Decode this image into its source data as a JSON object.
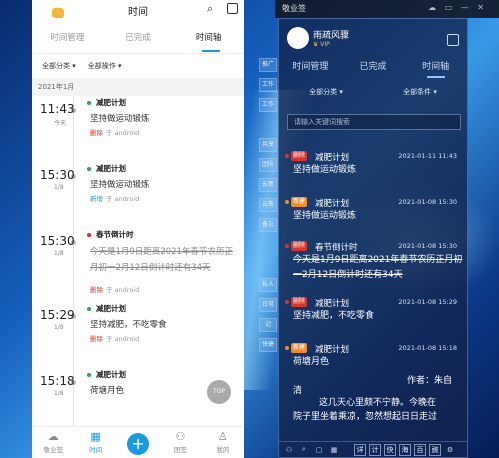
{
  "phone": {
    "title": "时间",
    "tabs": [
      "时间管理",
      "已完成",
      "时间轴"
    ],
    "filters": [
      "全部分类 ▾",
      "全部操作 ▾"
    ],
    "month": "2021年1月",
    "entries": [
      {
        "time": "11:43",
        "date": "今天",
        "title": "减肥计划",
        "content": "坚持做运动锻炼",
        "action": "删除",
        "source": "于 android",
        "bullet": "#2fa84f",
        "strike": false
      },
      {
        "time": "15:30",
        "date": "1/8",
        "title": "减肥计划",
        "content": "坚持做运动锻炼",
        "action": "新增",
        "source": "于 android",
        "bullet": "#2fa84f",
        "strike": false
      },
      {
        "time": "15:30",
        "date": "1/8",
        "title": "春节倒计时",
        "content": "今天是1月9日距离2021年春节农历正月初一2月12日倒计时还有34天",
        "action": "删除",
        "source": "于 android",
        "bullet": "#d9342b",
        "strike": true
      },
      {
        "time": "15:29",
        "date": "1/8",
        "title": "减肥计划",
        "content": "坚持减肥，不吃零食",
        "action": "删除",
        "source": "于 android",
        "bullet": "#2fa84f",
        "strike": false
      },
      {
        "time": "15:18",
        "date": "1/8",
        "title": "减肥计划",
        "content": "荷塘月色",
        "action": "",
        "source": "",
        "bullet": "#2fa84f",
        "strike": false
      }
    ],
    "top_button": "TOP",
    "nav": [
      "敬业签",
      "时间",
      "",
      "团签",
      "我的"
    ]
  },
  "widget": {
    "taskbar_app": "敬业签",
    "taskbar_icons": "☁ ▭ — ✕",
    "user_name": "雨疏风骤",
    "vip": "♛ VIP",
    "tabs": [
      "时间管理",
      "已完成",
      "时间轴"
    ],
    "filters": [
      "全部分类 ▾",
      "全部条件 ▾"
    ],
    "search_placeholder": "请输入关键词搜索",
    "entries": [
      {
        "badge": "删除",
        "badge_color": "#d9342b",
        "bullet": "#d9342b",
        "title": "减肥计划",
        "date": "2021-01-11 11:43",
        "content": "坚持做运动锻炼",
        "strike": false
      },
      {
        "badge": "新建",
        "badge_color": "#f08c2a",
        "bullet": "#f08c2a",
        "title": "减肥计划",
        "date": "2021-01-08 15:30",
        "content": "坚持做运动锻炼",
        "strike": false
      },
      {
        "badge": "删除",
        "badge_color": "#d9342b",
        "bullet": "#d9342b",
        "title": "春节倒计时",
        "date": "2021-01-08 15:30",
        "content": "今天是1月9日距离2021年春节农历正月初一2月12日倒计时还有34天",
        "strike": true
      },
      {
        "badge": "删除",
        "badge_color": "#d9342b",
        "bullet": "#d9342b",
        "title": "减肥计划",
        "date": "2021-01-08 15:29",
        "content": "坚持减肥，不吃零食",
        "strike": false
      },
      {
        "badge": "新建",
        "badge_color": "#f08c2a",
        "bullet": "#f08c2a",
        "title": "减肥计划",
        "date": "2021-01-08 15:18",
        "content": "荷塘月色",
        "strike": false
      }
    ],
    "poem_line1": "清",
    "poem_author": "作者：朱自",
    "poem_line2": "这几天心里颇不宁静。今晚在",
    "poem_line3": "院子里坐着乘凉，忽然想起日日走过",
    "bottom_buttons": [
      "详",
      "计",
      "快",
      "海",
      "百",
      "豌"
    ],
    "side_tabs": [
      "推广",
      "工作",
      "工作",
      "共享",
      "团队",
      "云笔",
      "云笔",
      "备忘",
      "私人",
      "日常",
      "记",
      "快捷"
    ]
  }
}
